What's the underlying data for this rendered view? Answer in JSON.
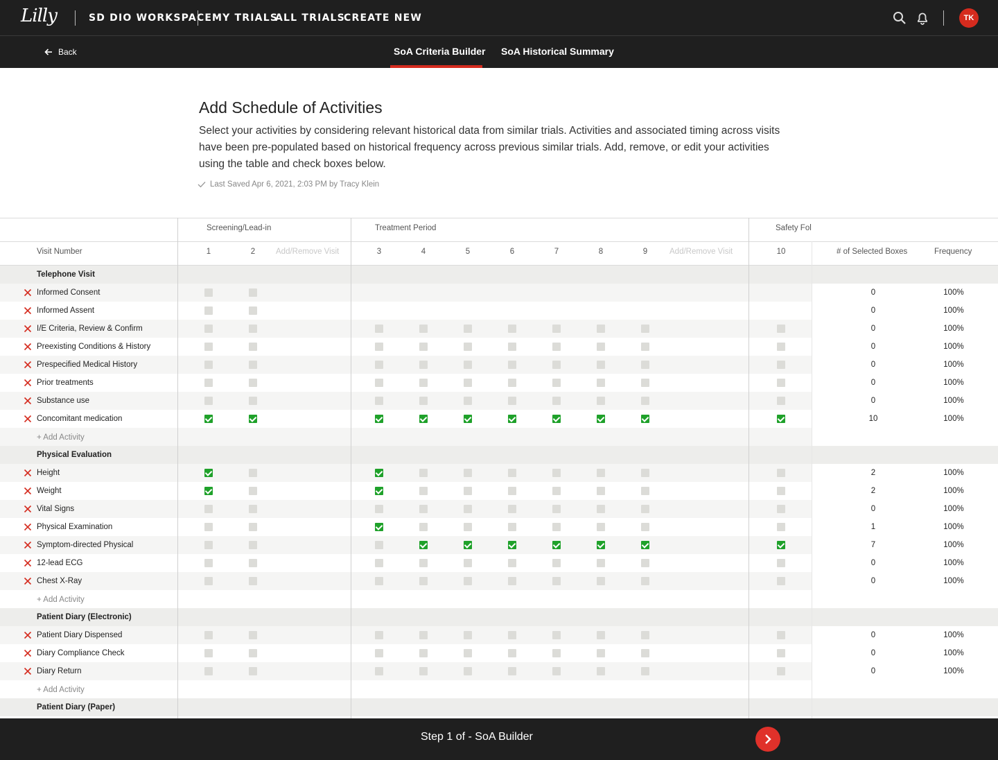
{
  "topbar": {
    "logo": "Lilly",
    "workspace": "SD DIO WORKSPACE",
    "nav": [
      "MY TRIALS",
      "ALL TRIALS",
      "CREATE NEW"
    ],
    "avatar_initials": "TK"
  },
  "subbar": {
    "back_label": "Back",
    "tabs": [
      "SoA Criteria Builder",
      "SoA Historical Summary"
    ],
    "active_tab": "SoA Criteria Builder"
  },
  "header": {
    "title": "Add Schedule of Activities",
    "description": "Select your activities by considering relevant historical data from similar trials. Activities and associated timing across visits have been pre-populated based on historical frequency across previous similar trials. Add, remove, or edit your activities using the table and check boxes below.",
    "last_saved": "Last Saved Apr 6, 2021, 2:03 PM by Tracy Klein"
  },
  "table": {
    "groups": [
      "Screening/Lead-in",
      "Treatment Period",
      "Safety Fol"
    ],
    "visit_number_label": "Visit Number",
    "visits": [
      "1",
      "2",
      "3",
      "4",
      "5",
      "6",
      "7",
      "8",
      "9",
      "10"
    ],
    "add_remove_visit": "Add/Remove Visit",
    "selected_label": "# of Selected Boxes",
    "frequency_label": "Frequency",
    "add_activity": "+ Add Activity",
    "sections": [
      {
        "name": "Telephone Visit",
        "rows": [
          {
            "label": "Informed Consent",
            "checks": [
              0,
              0,
              null,
              null,
              null,
              null,
              null,
              null,
              null,
              null
            ],
            "count": "0",
            "freq": "100%"
          },
          {
            "label": "Informed Assent",
            "checks": [
              0,
              0,
              null,
              null,
              null,
              null,
              null,
              null,
              null,
              null
            ],
            "count": "0",
            "freq": "100%"
          },
          {
            "label": "I/E Criteria, Review & Confirm",
            "checks": [
              0,
              0,
              0,
              0,
              0,
              0,
              0,
              0,
              0,
              0
            ],
            "count": "0",
            "freq": "100%"
          },
          {
            "label": "Preexisting Conditions & History",
            "checks": [
              0,
              0,
              0,
              0,
              0,
              0,
              0,
              0,
              0,
              0
            ],
            "count": "0",
            "freq": "100%"
          },
          {
            "label": "Prespecified Medical History",
            "checks": [
              0,
              0,
              0,
              0,
              0,
              0,
              0,
              0,
              0,
              0
            ],
            "count": "0",
            "freq": "100%"
          },
          {
            "label": "Prior treatments",
            "checks": [
              0,
              0,
              0,
              0,
              0,
              0,
              0,
              0,
              0,
              0
            ],
            "count": "0",
            "freq": "100%"
          },
          {
            "label": "Substance use",
            "checks": [
              0,
              0,
              0,
              0,
              0,
              0,
              0,
              0,
              0,
              0
            ],
            "count": "0",
            "freq": "100%"
          },
          {
            "label": "Concomitant medication",
            "checks": [
              1,
              1,
              1,
              1,
              1,
              1,
              1,
              1,
              1,
              1
            ],
            "count": "10",
            "freq": "100%"
          }
        ]
      },
      {
        "name": "Physical Evaluation",
        "rows": [
          {
            "label": "Height",
            "checks": [
              1,
              0,
              1,
              0,
              0,
              0,
              0,
              0,
              0,
              0
            ],
            "count": "2",
            "freq": "100%"
          },
          {
            "label": "Weight",
            "checks": [
              1,
              0,
              1,
              0,
              0,
              0,
              0,
              0,
              0,
              0
            ],
            "count": "2",
            "freq": "100%"
          },
          {
            "label": "Vital Signs",
            "checks": [
              0,
              0,
              0,
              0,
              0,
              0,
              0,
              0,
              0,
              0
            ],
            "count": "0",
            "freq": "100%"
          },
          {
            "label": "Physical Examination",
            "checks": [
              0,
              0,
              1,
              0,
              0,
              0,
              0,
              0,
              0,
              0
            ],
            "count": "1",
            "freq": "100%"
          },
          {
            "label": "Symptom-directed Physical",
            "checks": [
              0,
              0,
              0,
              1,
              1,
              1,
              1,
              1,
              1,
              1
            ],
            "count": "7",
            "freq": "100%"
          },
          {
            "label": "12-lead ECG",
            "checks": [
              0,
              0,
              0,
              0,
              0,
              0,
              0,
              0,
              0,
              0
            ],
            "count": "0",
            "freq": "100%"
          },
          {
            "label": "Chest X-Ray",
            "checks": [
              0,
              0,
              0,
              0,
              0,
              0,
              0,
              0,
              0,
              0
            ],
            "count": "0",
            "freq": "100%"
          }
        ]
      },
      {
        "name": "Patient Diary (Electronic)",
        "rows": [
          {
            "label": "Patient Diary Dispensed",
            "checks": [
              0,
              0,
              0,
              0,
              0,
              0,
              0,
              0,
              0,
              0
            ],
            "count": "0",
            "freq": "100%"
          },
          {
            "label": "Diary Compliance Check",
            "checks": [
              0,
              0,
              0,
              0,
              0,
              0,
              0,
              0,
              0,
              0
            ],
            "count": "0",
            "freq": "100%"
          },
          {
            "label": "Diary Return",
            "checks": [
              0,
              0,
              0,
              0,
              0,
              0,
              0,
              0,
              0,
              0
            ],
            "count": "0",
            "freq": "100%"
          }
        ]
      },
      {
        "name": "Patient Diary (Paper)",
        "rows": []
      }
    ]
  },
  "footer": {
    "step_text": "Step 1 of  - SoA Builder"
  },
  "colors": {
    "accent": "#d52b1e",
    "check_on": "#1fa12a",
    "check_off": "#dcdcd8",
    "bar": "#1f1f1f"
  }
}
